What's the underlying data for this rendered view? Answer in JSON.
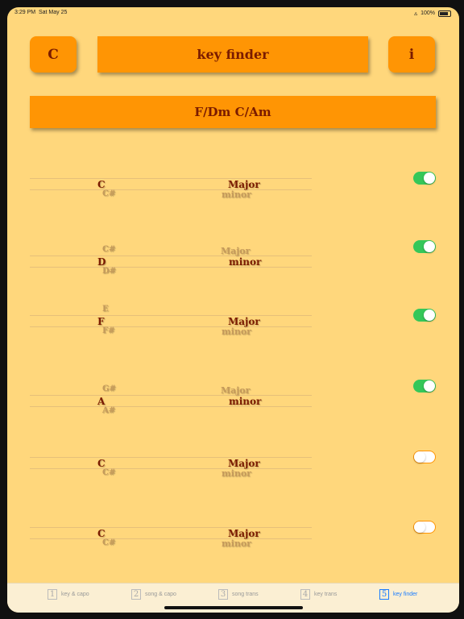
{
  "status": {
    "time": "3:29 PM",
    "date": "Sat May 25",
    "battery": "100%"
  },
  "header": {
    "key_label": "C",
    "title": "key finder",
    "info_label": "i"
  },
  "keys_bar": "F/Dm   C/Am",
  "rows": [
    {
      "above_note": "",
      "note": "C",
      "below_note": "C#",
      "above_mode": "",
      "mode": "Major",
      "below_mode": "minor",
      "mode_on_main": "major",
      "toggle": "on"
    },
    {
      "above_note": "C#",
      "note": "D",
      "below_note": "D#",
      "above_mode": "Major",
      "mode": "minor",
      "below_mode": "",
      "mode_on_main": "minor",
      "toggle": "on"
    },
    {
      "above_note": "E",
      "note": "F",
      "below_note": "F#",
      "above_mode": "",
      "mode": "Major",
      "below_mode": "minor",
      "mode_on_main": "major",
      "toggle": "on"
    },
    {
      "above_note": "G#",
      "note": "A",
      "below_note": "A#",
      "above_mode": "Major",
      "mode": "minor",
      "below_mode": "",
      "mode_on_main": "minor",
      "toggle": "on"
    },
    {
      "above_note": "",
      "note": "C",
      "below_note": "C#",
      "above_mode": "",
      "mode": "Major",
      "below_mode": "minor",
      "mode_on_main": "major",
      "toggle": "off"
    },
    {
      "above_note": "",
      "note": "C",
      "below_note": "C#",
      "above_mode": "",
      "mode": "Major",
      "below_mode": "minor",
      "mode_on_main": "major",
      "toggle": "off"
    }
  ],
  "tabs": [
    {
      "num": "1",
      "label": "key & capo"
    },
    {
      "num": "2",
      "label": "song & capo"
    },
    {
      "num": "3",
      "label": "song trans"
    },
    {
      "num": "4",
      "label": "key trans"
    },
    {
      "num": "5",
      "label": "key finder",
      "active": true
    }
  ],
  "colors": {
    "background": "#ffd77c",
    "button": "#ff9504",
    "text": "#7a1b00",
    "toggle_on": "#35c759",
    "active_tab": "#1a7cff"
  }
}
